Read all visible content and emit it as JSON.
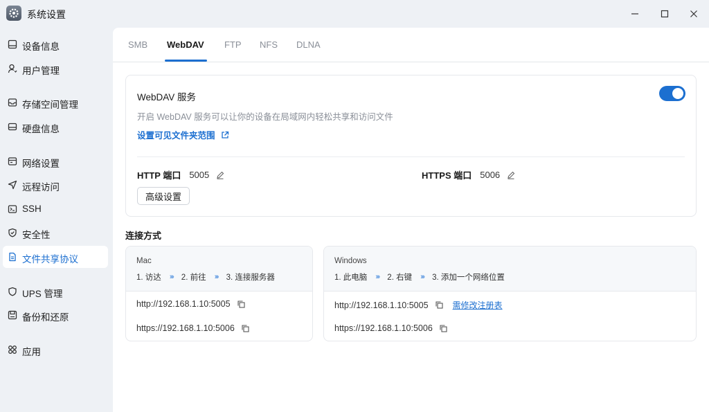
{
  "window": {
    "title": "系统设置",
    "controls": {
      "minimize": "minimize",
      "maximize": "maximize",
      "close": "close"
    }
  },
  "sidebar": {
    "items": [
      {
        "label": "设备信息",
        "icon": "device-info-icon"
      },
      {
        "label": "用户管理",
        "icon": "user-icon"
      },
      {
        "label": "存储空间管理",
        "icon": "storage-icon"
      },
      {
        "label": "硬盘信息",
        "icon": "disk-icon"
      },
      {
        "label": "网络设置",
        "icon": "network-icon"
      },
      {
        "label": "远程访问",
        "icon": "remote-access-icon"
      },
      {
        "label": "SSH",
        "icon": "terminal-icon"
      },
      {
        "label": "安全性",
        "icon": "shield-icon"
      },
      {
        "label": "文件共享协议",
        "icon": "document-icon",
        "active": true
      },
      {
        "label": "UPS 管理",
        "icon": "ups-shield-icon"
      },
      {
        "label": "备份和还原",
        "icon": "backup-icon"
      },
      {
        "label": "应用",
        "icon": "apps-icon"
      }
    ]
  },
  "tabs": [
    "SMB",
    "WebDAV",
    "FTP",
    "NFS",
    "DLNA"
  ],
  "active_tab": "WebDAV",
  "service": {
    "title": "WebDAV 服务",
    "description": "开启 WebDAV 服务可以让你的设备在局域网内轻松共享和访问文件",
    "link": "设置可见文件夹范围",
    "enabled": true,
    "http_label": "HTTP 端口",
    "http_port": "5005",
    "https_label": "HTTPS 端口",
    "https_port": "5006",
    "advanced_button": "高级设置"
  },
  "connection": {
    "title": "连接方式",
    "mac": {
      "name": "Mac",
      "steps": [
        "1. 访达",
        "2. 前往",
        "3. 连接服务器"
      ],
      "urls": [
        "http://192.168.1.10:5005",
        "https://192.168.1.10:5006"
      ]
    },
    "windows": {
      "name": "Windows",
      "steps": [
        "1. 此电脑",
        "2. 右键",
        "3. 添加一个网络位置"
      ],
      "urls": [
        "http://192.168.1.10:5005",
        "https://192.168.1.10:5006"
      ],
      "registry_link": "需修改注册表"
    }
  },
  "colors": {
    "accent": "#1c6fd0",
    "sidebar_bg": "#eef1f5",
    "muted": "#8a8f98"
  }
}
